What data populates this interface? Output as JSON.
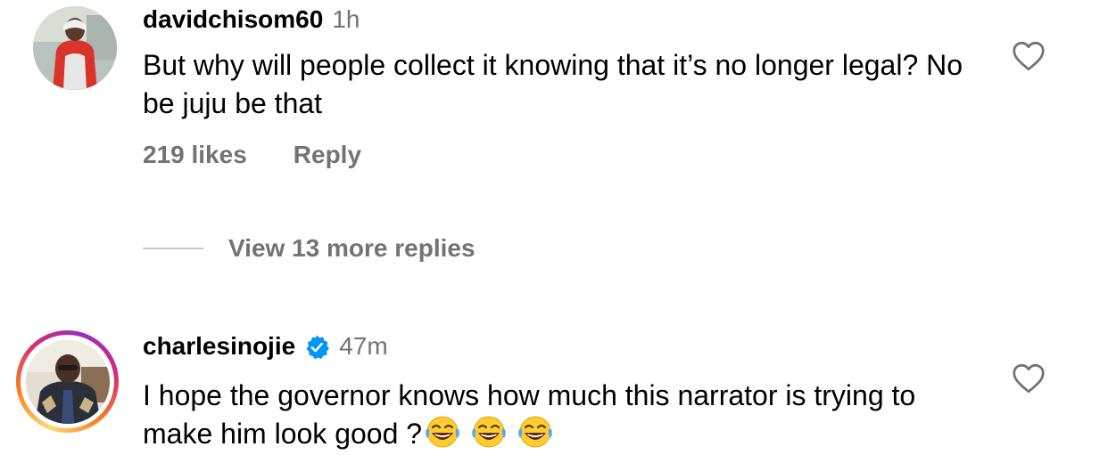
{
  "comments": [
    {
      "username": "davidchisom60",
      "time": "1h",
      "text": "But why will people collect it knowing that it’s no longer legal? No be juju be that",
      "likes": "219 likes",
      "reply_label": "Reply",
      "view_replies": "View 13 more replies",
      "avatar_icon": "user-photo-red-hoodie",
      "like_icon": "heart-outline-icon"
    },
    {
      "username": "charlesinojie",
      "verified": true,
      "verified_icon": "verified-badge-icon",
      "time": "47m",
      "text": "I hope the governor knows how much this narrator is trying to make him look good ?",
      "emojis": [
        "😂",
        "😂",
        "😂"
      ],
      "emoji_icon": "face-with-tears-of-joy",
      "avatar_icon": "user-photo-man-patterned-shirt",
      "has_story_ring": true,
      "like_icon": "heart-outline-icon"
    }
  ],
  "colors": {
    "secondary_text": "#737373",
    "verified_blue": "#0095f6",
    "divider": "#c7c7c7"
  }
}
